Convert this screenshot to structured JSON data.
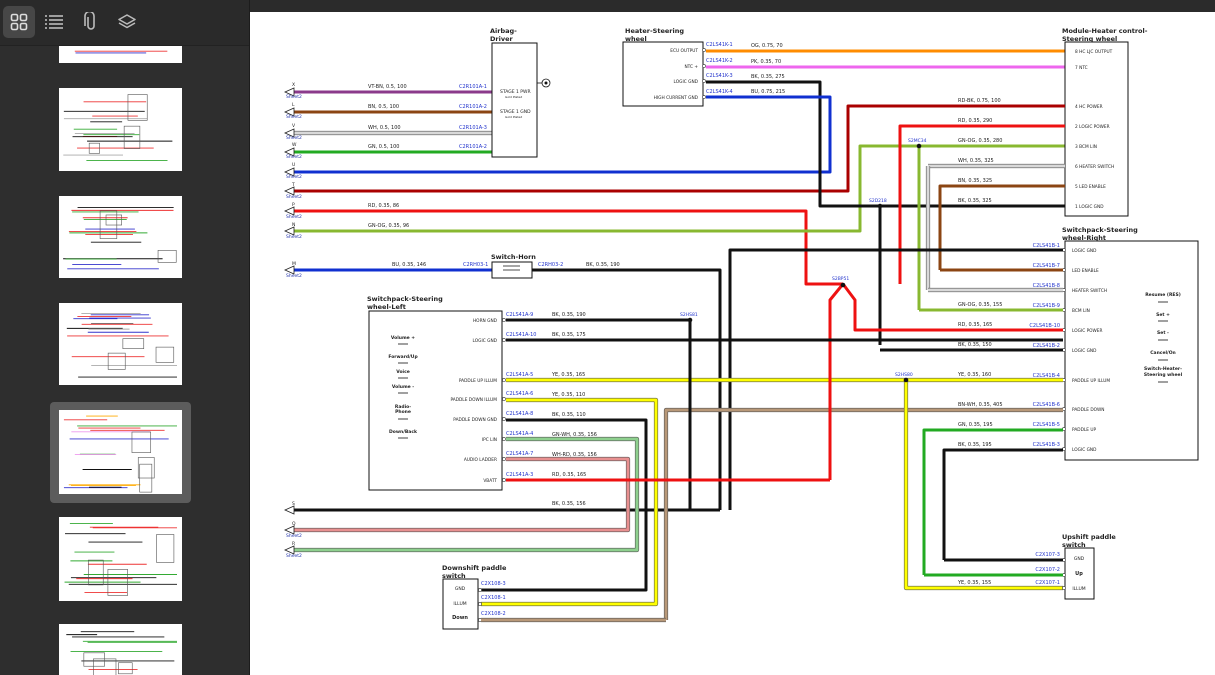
{
  "toolbar": {
    "buttons": [
      {
        "name": "thumbnail-view-icon",
        "active": true
      },
      {
        "name": "outline-view-icon",
        "active": false
      },
      {
        "name": "attachments-icon",
        "active": false
      },
      {
        "name": "layers-icon",
        "active": false
      }
    ]
  },
  "thumbnails": {
    "count": 7,
    "selected_index": 4
  },
  "diagram": {
    "components": {
      "airbag": {
        "title1": "Airbag-",
        "title2": "Driver",
        "stage1": "STAGE 1 PWR",
        "stage1_sub": "Gold Plated",
        "stage2": "STAGE 1 GND",
        "stage2_sub": "Gold Plated"
      },
      "heater_wheel": {
        "title1": "Heater-Steering",
        "title2": "wheel",
        "pins": [
          "ECU OUTPUT",
          "NTC +",
          "LOGIC GND",
          "HIGH CURRENT GND"
        ]
      },
      "module_heater": {
        "title1": "Module-Heater control-",
        "title2": "Steering wheel",
        "pins": [
          "8  HC LJC OUTPUT",
          "7   NTC",
          "4   HC POWER",
          "2  LOGIC POWER",
          "3   BCM LIN",
          "6  HEATER SWITCH",
          "5   LED ENABLE",
          "1   LOGIC GND"
        ]
      },
      "switchpack_right": {
        "title1": "Switchpack-Steering",
        "title2": "wheel-Right",
        "pins": [
          "LOGIC GND",
          "LED ENABLE",
          "HEATER SWITCH",
          "BCM LIN",
          "LOGIC POWER",
          "LOGIC GND",
          "PADDLE UP ILLUM",
          "PADDLE DOWN",
          "PADDLE UP",
          "LOGIC GND"
        ],
        "buttons": [
          "Resume (RES)",
          "Set +",
          "Set -",
          "Cancel/On",
          "Switch-Heater-",
          "Steering wheel"
        ]
      },
      "switchpack_left": {
        "title1": "Switchpack-Steering",
        "title2": "wheel-Left",
        "pins": [
          "HORN GND",
          "LOGIC GND",
          "PADDLE UP ILLUM",
          "PADDLE DOWN ILLUM",
          "PADDLE DOWN GND",
          "IPC LIN",
          "AUDIO LADDER",
          "VBATT"
        ],
        "buttons": [
          "Volume +",
          "Forward/Up",
          "Voice",
          "Volume -",
          "Radio-",
          "Phone",
          "Down/Back"
        ]
      },
      "horn": {
        "title": "Switch-Horn"
      },
      "downshift": {
        "title1": "Downshift paddle",
        "title2": "switch",
        "pins": [
          "GND",
          "ILLUM",
          "Down"
        ]
      },
      "upshift": {
        "title1": "Upshift paddle",
        "title2": "switch",
        "pins": [
          "GND",
          "Up",
          "ILLUM"
        ]
      }
    },
    "connectors": {
      "left": [
        "C2R101A-1",
        "C2R101A-2",
        "C2R101A-3",
        "C2R101A-2"
      ],
      "heater": [
        "C2LS41K-1",
        "C2LS41K-2",
        "C2LS41K-3",
        "C2LS41K-4"
      ],
      "horn_in": "C2RH03-1",
      "horn_out": "C2RH03-2",
      "swl": [
        "C2LS41A-9",
        "C2LS41A-10",
        "C2LS41A-5",
        "C2LS41A-6",
        "C2LS41A-8",
        "C2LS41A-4",
        "C2LS41A-7",
        "C2LS41A-3"
      ],
      "swr": [
        "C2LS41B-1",
        "C2LS41B-7",
        "C2LS41B-8",
        "C2LS41B-9",
        "C2LS41B-10",
        "C2LS41B-2",
        "C2LS41B-4",
        "C2LS41B-6",
        "C2LS41B-5",
        "C2LS41B-3"
      ],
      "down": [
        "C2X108-3",
        "C2X108-1",
        "C2X108-2"
      ],
      "up": [
        "C2X107-3",
        "C2X107-2",
        "C2X107-1"
      ]
    },
    "splices": [
      "S2MC34",
      "S2D218",
      "S2BP51",
      "S2HS81",
      "S2HS80"
    ],
    "sheet": "Sheet2",
    "offpage": [
      "X",
      "L",
      "V",
      "W",
      "U",
      "T",
      "P",
      "N",
      "M",
      "S",
      "Q",
      "R"
    ],
    "wires": {
      "x": "VT-BN, 0.5, 100",
      "l": "BN, 0.5, 100",
      "v": "WH, 0.5, 100",
      "w": "GN, 0.5, 100",
      "p": "RD, 0.35, 86",
      "n": "GN-OG, 0.35, 96",
      "m": "BU, 0.35, 146",
      "horn": "BK, 0.35, 190",
      "h1": "OG, 0.75, 70",
      "h2": "PK, 0.35, 70",
      "h3": "BK, 0.35, 275",
      "h4": "BU, 0.75, 215",
      "m4": "RD-BK, 0.75, 100",
      "m2": "RD, 0.35, 290",
      "m3": "GN-OG, 0.35, 280",
      "m6": "WH, 0.35, 325",
      "m5": "BN, 0.35, 325",
      "m1": "BK, 0.35, 325",
      "sl9": "BK, 0.35, 190",
      "sl10": "BK, 0.35, 175",
      "sl5": "YE, 0.35, 165",
      "sl6": "YE, 0.35, 110",
      "sl8": "BK, 0.35, 110",
      "sl4": "GN-WH, 0.35, 156",
      "sl7": "WH-RD, 0.35, 156",
      "sl3": "RD, 0.35, 165",
      "s": "BK, 0.35, 156",
      "r9": "GN-OG, 0.35, 155",
      "r10": "RD, 0.35, 165",
      "r2": "BK, 0.35, 150",
      "r4": "YE, 0.35, 160",
      "r6": "BN-WH, 0.35, 405",
      "r5": "GN, 0.35, 195",
      "r3": "BK, 0.35, 195",
      "u1": "YE, 0.35, 155"
    },
    "colors": {
      "VT-BN": "#8b3a8b",
      "BN": "#8b4513",
      "WH": "#d9d9d9",
      "GN": "#22aa22",
      "BU": "#1030d0",
      "BK": "#111111",
      "RD": "#ee1111",
      "GN-OG": "#88b830",
      "OG": "#ff8c00",
      "PK": "#ee66ee",
      "RD-BK": "#aa0000",
      "YE": "#ffff00",
      "GN-WH": "#8ed08e",
      "WH-RD": "#e89090",
      "BN-WH": "#b89878"
    }
  }
}
